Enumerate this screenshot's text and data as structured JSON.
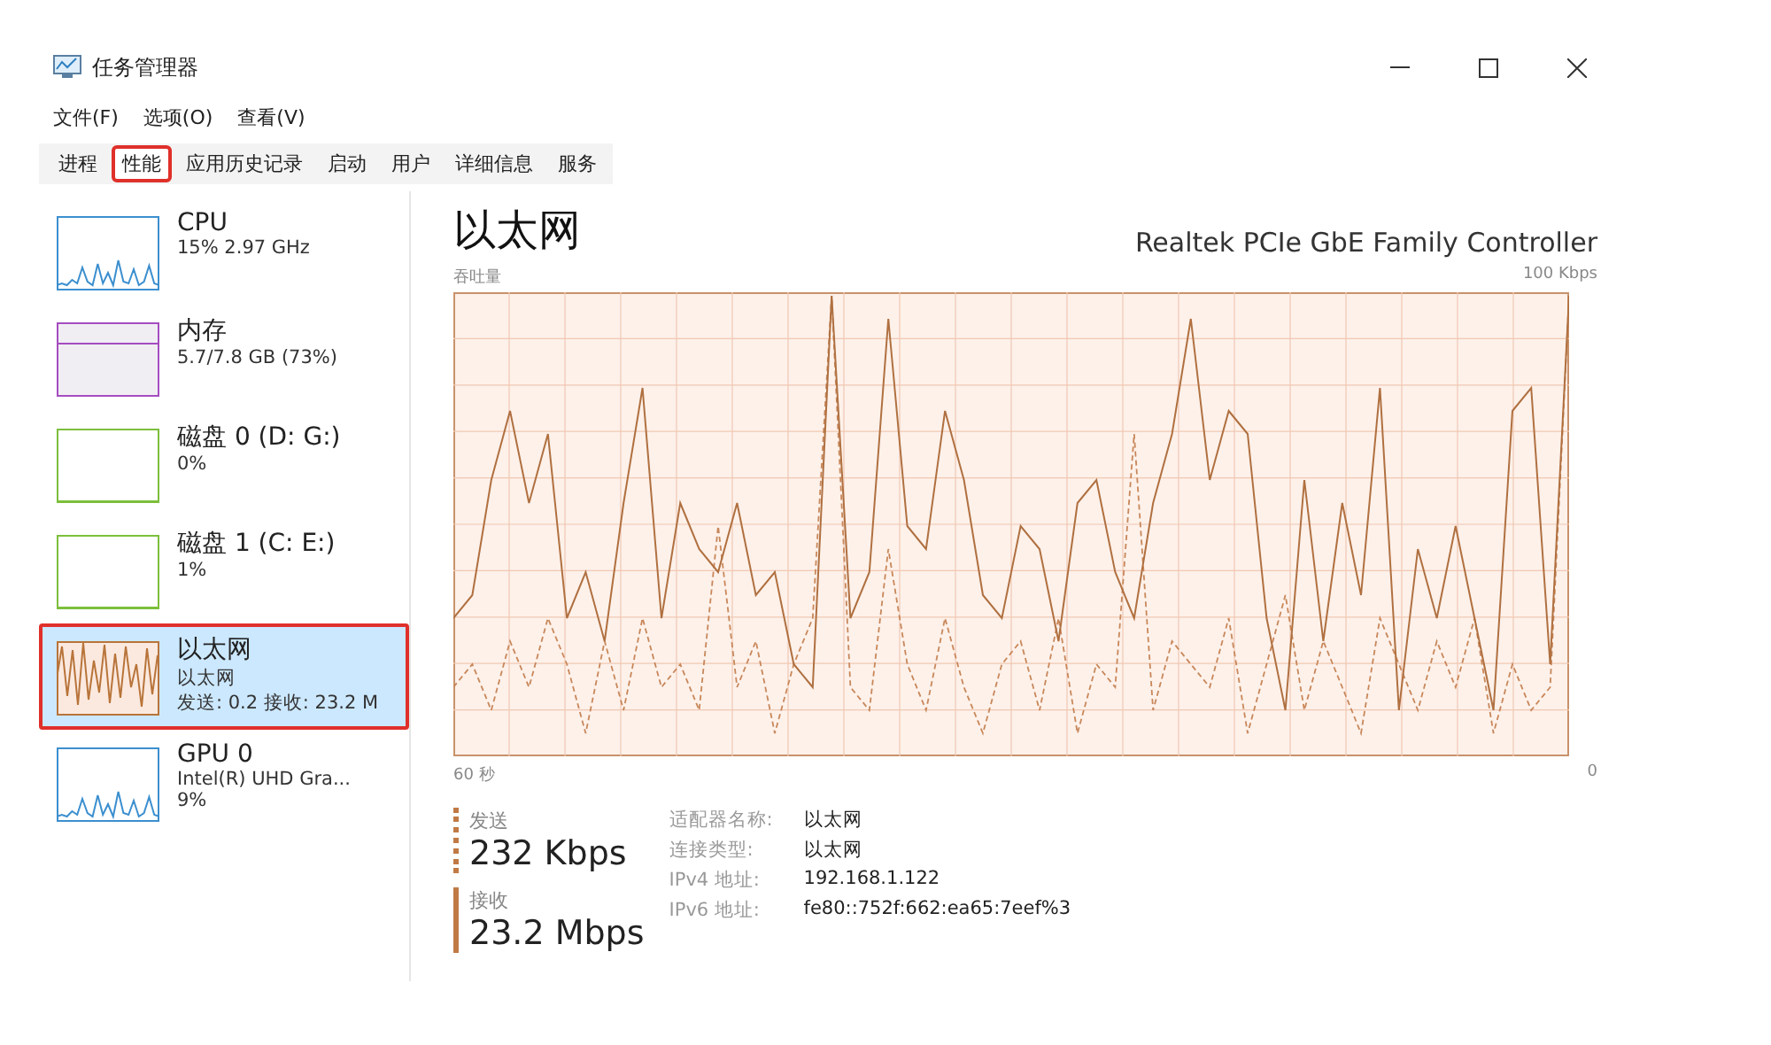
{
  "window": {
    "title": "任务管理器"
  },
  "menu": [
    "文件(F)",
    "选项(O)",
    "查看(V)"
  ],
  "tabs": [
    {
      "label": "进程",
      "selected": false
    },
    {
      "label": "性能",
      "selected": true
    },
    {
      "label": "应用历史记录",
      "selected": false
    },
    {
      "label": "启动",
      "selected": false
    },
    {
      "label": "用户",
      "selected": false
    },
    {
      "label": "详细信息",
      "selected": false
    },
    {
      "label": "服务",
      "selected": false
    }
  ],
  "sidebar": {
    "items": [
      {
        "name": "CPU",
        "lines": [
          "15% 2.97 GHz"
        ],
        "kind": "spiky",
        "color": "#3c8fcf",
        "selected": false
      },
      {
        "name": "内存",
        "lines": [
          "5.7/7.8 GB (73%)"
        ],
        "kind": "filled",
        "color": "#a54cc0",
        "selected": false
      },
      {
        "name": "磁盘 0 (D: G:)",
        "lines": [
          "0%"
        ],
        "kind": "flat",
        "color": "#7cbf3c",
        "selected": false
      },
      {
        "name": "磁盘 1 (C: E:)",
        "lines": [
          "1%"
        ],
        "kind": "flat",
        "color": "#7cbf3c",
        "selected": false
      },
      {
        "name": "以太网",
        "lines": [
          "以太网",
          "发送: 0.2 接收: 23.2 M"
        ],
        "kind": "dense",
        "color": "#b8743a",
        "selected": true
      },
      {
        "name": "GPU 0",
        "lines": [
          "Intel(R) UHD Gra...",
          "9%"
        ],
        "kind": "spiky",
        "color": "#3c8fcf",
        "selected": false
      }
    ]
  },
  "detail": {
    "title": "以太网",
    "adapter": "Realtek PCIe GbE Family Controller",
    "graph_label": "吞吐量",
    "graph_max": "100 Kbps",
    "graph_span": "60 秒",
    "graph_min": "0",
    "send": {
      "label": "发送",
      "value": "232 Kbps"
    },
    "receive": {
      "label": "接收",
      "value": "23.2 Mbps"
    },
    "properties": [
      {
        "label": "适配器名称:",
        "value": "以太网"
      },
      {
        "label": "连接类型:",
        "value": "以太网"
      },
      {
        "label": "IPv4 地址:",
        "value": "192.168.1.122"
      },
      {
        "label": "IPv6 地址:",
        "value": "fe80::752f:662:ea65:7eef%3"
      }
    ]
  }
}
